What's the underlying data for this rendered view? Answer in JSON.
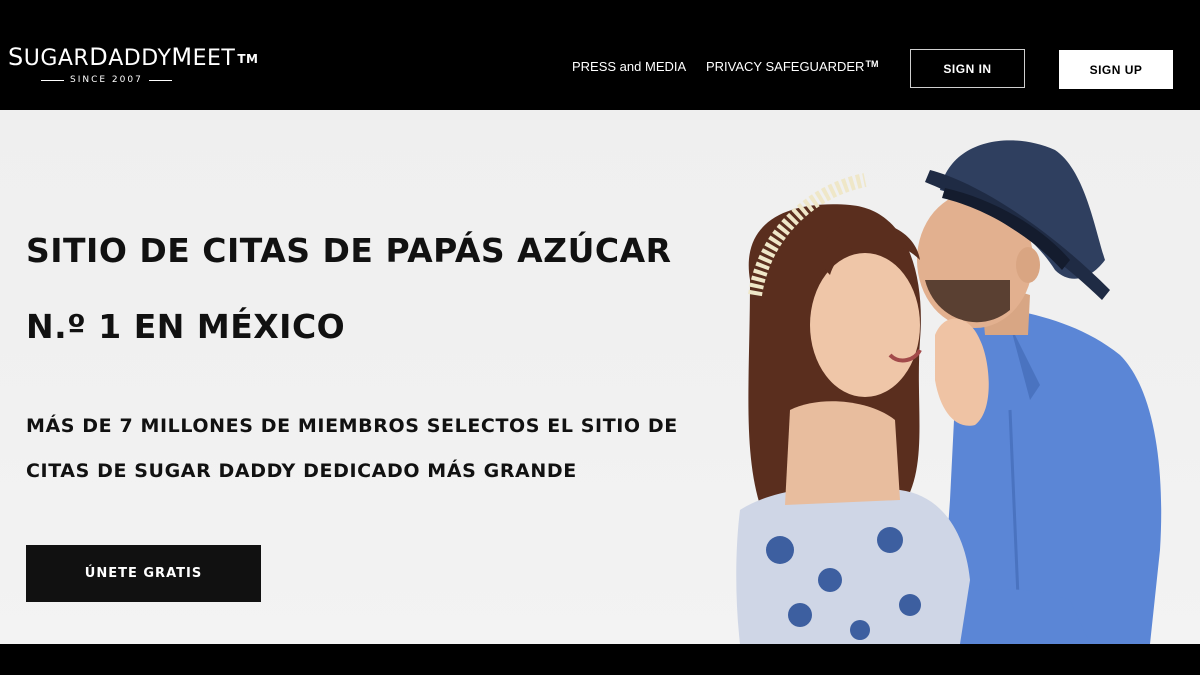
{
  "brand": {
    "logo_parts": [
      "S",
      "UGAR",
      "D",
      "ADDY",
      "M",
      "EET"
    ],
    "logo_tm": "TM",
    "since": "SINCE 2007"
  },
  "nav": {
    "press": "PRESS and MEDIA",
    "privacy": "PRIVACY SAFEGUARDER",
    "privacy_tm": "TM",
    "sign_in": "SIGN IN",
    "sign_up": "SIGN UP"
  },
  "hero": {
    "title_line1": "SITIO DE CITAS DE PAPÁS AZÚCAR",
    "title_line2": "N.º 1 EN MÉXICO",
    "subtitle_line1": "MÁS DE 7 MILLONES DE MIEMBROS SELECTOS EL SITIO DE",
    "subtitle_line2": "CITAS DE SUGAR DADDY DEDICADO MÁS GRANDE",
    "cta": "ÚNETE GRATIS"
  },
  "colors": {
    "header_bg": "#000000",
    "hero_bg": "#f0f0f0",
    "text_dark": "#111111",
    "shirt_blue": "#5b86d6",
    "hat_navy": "#2c3b5a"
  },
  "icons": {
    "scroll_top": "triangle-up-icon"
  }
}
